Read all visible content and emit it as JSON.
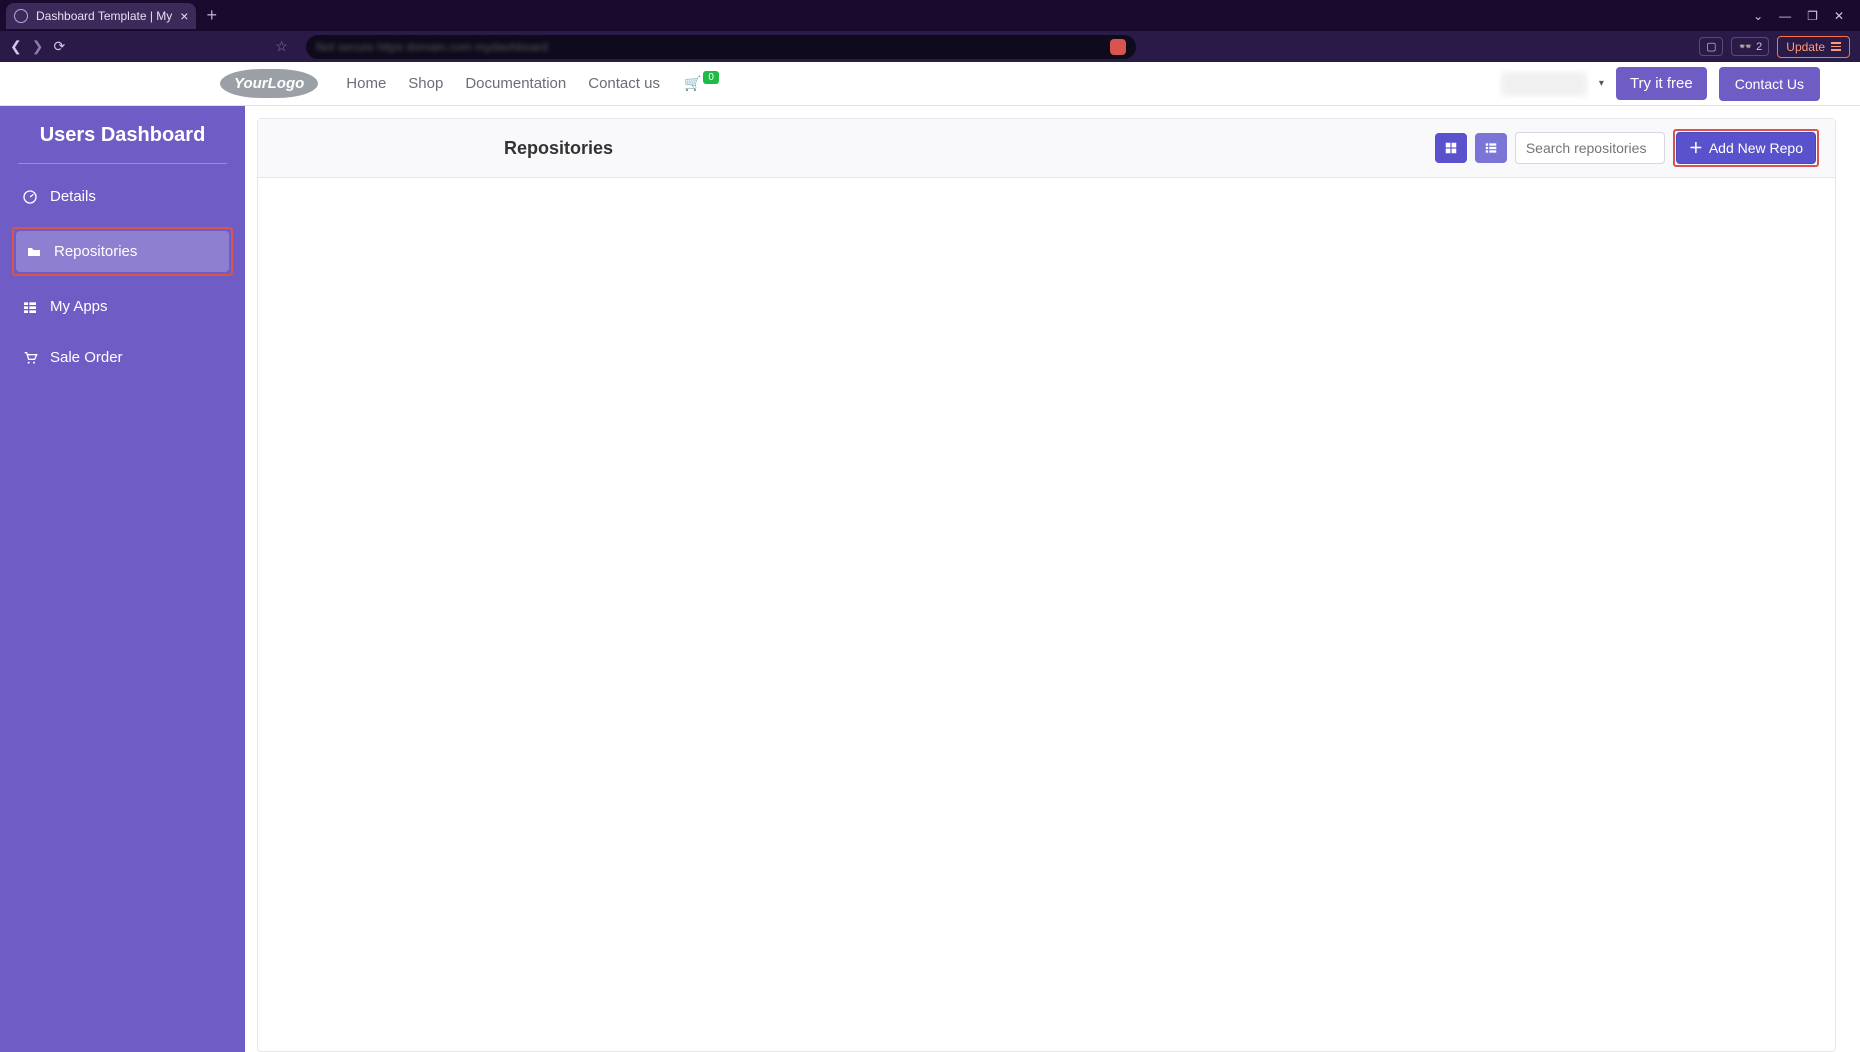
{
  "browser": {
    "tab_title": "Dashboard Template | My",
    "update_label": "Update",
    "shield_count": "2"
  },
  "nav": {
    "links": [
      "Home",
      "Shop",
      "Documentation",
      "Contact us"
    ],
    "cart_count": "0",
    "try_free": "Try it free",
    "contact": "Contact Us"
  },
  "sidebar": {
    "title": "Users Dashboard",
    "items": [
      {
        "label": "Details"
      },
      {
        "label": "Repositories"
      },
      {
        "label": "My Apps"
      },
      {
        "label": "Sale Order"
      }
    ]
  },
  "panel": {
    "title": "Repositories",
    "search_placeholder": "Search repositories",
    "add_label": "Add New Repo"
  }
}
